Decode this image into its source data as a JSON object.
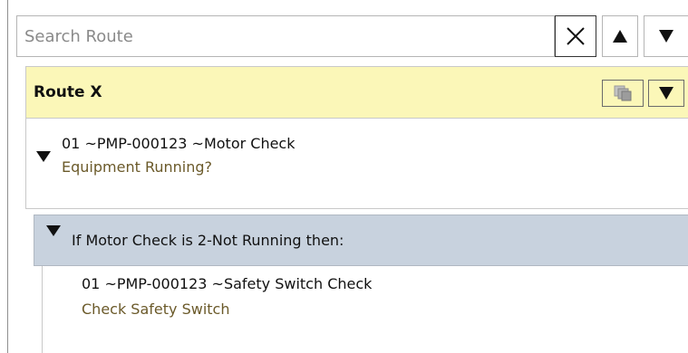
{
  "search": {
    "placeholder": "Search Route",
    "value": ""
  },
  "toolbar": {
    "clear_icon": "close-icon",
    "prev_icon": "triangle-up-icon",
    "next_icon": "triangle-down-icon"
  },
  "route": {
    "title": "Route X",
    "copy_icon": "copy-icon",
    "menu_icon": "triangle-down-icon"
  },
  "items": [
    {
      "title": "01 ~PMP-000123 ~Motor Check",
      "subtitle": "Equipment Running?",
      "expanded": true
    }
  ],
  "condition": {
    "text": "If Motor Check is 2-Not Running then:",
    "expanded": true,
    "items": [
      {
        "title": "01 ~PMP-000123 ~Safety Switch Check",
        "subtitle": "Check Safety Switch"
      }
    ]
  },
  "colors": {
    "route_header_bg": "#fbf7b8",
    "condition_bg": "#c8d2de",
    "subtitle_text": "#6b5a2a"
  }
}
